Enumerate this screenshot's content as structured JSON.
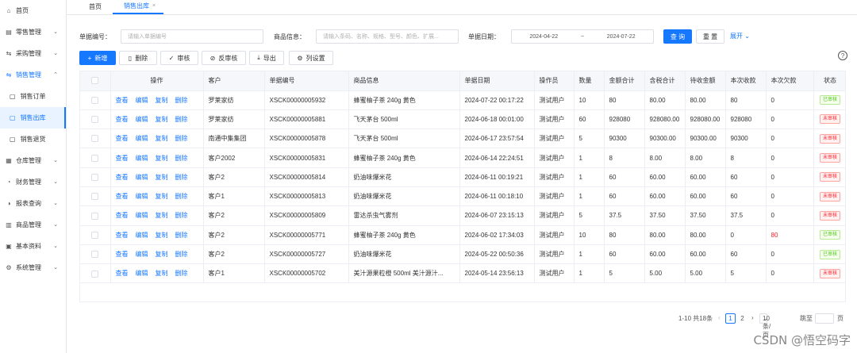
{
  "sidebar": {
    "items": [
      {
        "label": "首页",
        "icon": "home-icon",
        "glyph": "⌂",
        "has_chevron": false
      },
      {
        "label": "零售管理",
        "icon": "shop-icon",
        "glyph": "▤",
        "has_chevron": true
      },
      {
        "label": "采购管理",
        "icon": "cart-icon",
        "glyph": "⇆",
        "has_chevron": true
      },
      {
        "label": "销售管理",
        "icon": "sales-icon",
        "glyph": "⇋",
        "has_chevron": true,
        "expanded": true
      },
      {
        "label": "仓库管理",
        "icon": "warehouse-icon",
        "glyph": "▦",
        "has_chevron": true
      },
      {
        "label": "财务管理",
        "icon": "finance-icon",
        "glyph": "◔",
        "has_chevron": true
      },
      {
        "label": "报表查询",
        "icon": "report-icon",
        "glyph": "◑",
        "has_chevron": true
      },
      {
        "label": "商品管理",
        "icon": "goods-icon",
        "glyph": "▥",
        "has_chevron": true
      },
      {
        "label": "基本资料",
        "icon": "basic-data-icon",
        "glyph": "▣",
        "has_chevron": true
      },
      {
        "label": "系统管理",
        "icon": "system-icon",
        "glyph": "⚙",
        "has_chevron": true
      }
    ],
    "sub_items": [
      {
        "label": "销售订单",
        "icon": "doc-icon",
        "glyph": "▢",
        "active": false
      },
      {
        "label": "销售出库",
        "icon": "doc-icon",
        "glyph": "▢",
        "active": true
      },
      {
        "label": "销售退货",
        "icon": "doc-icon",
        "glyph": "▢",
        "active": false
      }
    ]
  },
  "tabs": [
    {
      "label": "首页",
      "active": false
    },
    {
      "label": "销售出库",
      "active": true,
      "close": "×"
    }
  ],
  "filters": {
    "doc_no_label": "单据编号：",
    "doc_no_placeholder": "请输入单据编号",
    "goods_label": "商品信息：",
    "goods_placeholder": "请输入条码、名称、规格、型号、颜色、扩展...",
    "date_label": "单据日期：",
    "date_start": "2024-04-22",
    "date_sep": "~",
    "date_end": "2024-07-22",
    "search_button": "查 询",
    "reset_button": "重 置",
    "expand_link": "展开"
  },
  "toolbar": {
    "add": "新增",
    "delete": "删除",
    "approve": "审核",
    "unapprove": "反审核",
    "export": "导出",
    "columns": "列设置"
  },
  "help_glyph": "?",
  "table": {
    "headers": [
      "操作",
      "客户",
      "单据编号",
      "商品信息",
      "单据日期",
      "操作员",
      "数量",
      "金额合计",
      "含税合计",
      "待收金额",
      "本次收款",
      "本次欠款",
      "状态"
    ],
    "actions": [
      "查看",
      "编辑",
      "复制",
      "删除"
    ],
    "rows": [
      {
        "customer": "罗莱家纺",
        "doc_no": "XSCK00000005932",
        "goods": "蜂蜜柚子茶 240g 黄色",
        "date": "2024-07-22 00:17:22",
        "operator": "测试用户",
        "qty": "10",
        "amount": "80",
        "tax_total": "80.00",
        "due": "80.00",
        "received": "80",
        "debt": "0",
        "debt_red": false,
        "status": "已审核",
        "status_ok": true
      },
      {
        "customer": "罗莱家纺",
        "doc_no": "XSCK00000005881",
        "goods": "飞天茅台 500ml",
        "date": "2024-06-18 00:01:00",
        "operator": "测试用户",
        "qty": "60",
        "amount": "928080",
        "tax_total": "928080.00",
        "due": "928080.00",
        "received": "928080",
        "debt": "0",
        "debt_red": false,
        "status": "未审核",
        "status_ok": false
      },
      {
        "customer": "南通中集集团",
        "doc_no": "XSCK00000005878",
        "goods": "飞天茅台 500ml",
        "date": "2024-06-17 23:57:54",
        "operator": "测试用户",
        "qty": "5",
        "amount": "90300",
        "tax_total": "90300.00",
        "due": "90300.00",
        "received": "90300",
        "debt": "0",
        "debt_red": false,
        "status": "未审核",
        "status_ok": false
      },
      {
        "customer": "客户2002",
        "doc_no": "XSCK00000005831",
        "goods": "蜂蜜柚子茶 240g 黄色",
        "date": "2024-06-14 22:24:51",
        "operator": "测试用户",
        "qty": "1",
        "amount": "8",
        "tax_total": "8.00",
        "due": "8.00",
        "received": "8",
        "debt": "0",
        "debt_red": false,
        "status": "未审核",
        "status_ok": false
      },
      {
        "customer": "客户2",
        "doc_no": "XSCK00000005814",
        "goods": "奶油味爆米花",
        "date": "2024-06-11 00:19:21",
        "operator": "测试用户",
        "qty": "1",
        "amount": "60",
        "tax_total": "60.00",
        "due": "60.00",
        "received": "60",
        "debt": "0",
        "debt_red": false,
        "status": "未审核",
        "status_ok": false
      },
      {
        "customer": "客户1",
        "doc_no": "XSCK00000005813",
        "goods": "奶油味爆米花",
        "date": "2024-06-11 00:18:10",
        "operator": "测试用户",
        "qty": "1",
        "amount": "60",
        "tax_total": "60.00",
        "due": "60.00",
        "received": "60",
        "debt": "0",
        "debt_red": false,
        "status": "未审核",
        "status_ok": false
      },
      {
        "customer": "客户2",
        "doc_no": "XSCK00000005809",
        "goods": "雷达杀虫气雾剂",
        "date": "2024-06-07 23:15:13",
        "operator": "测试用户",
        "qty": "5",
        "amount": "37.5",
        "tax_total": "37.50",
        "due": "37.50",
        "received": "37.5",
        "debt": "0",
        "debt_red": false,
        "status": "未审核",
        "status_ok": false
      },
      {
        "customer": "客户2",
        "doc_no": "XSCK00000005771",
        "goods": "蜂蜜柚子茶 240g 黄色",
        "date": "2024-06-02 17:34:03",
        "operator": "测试用户",
        "qty": "10",
        "amount": "80",
        "tax_total": "80.00",
        "due": "80.00",
        "received": "0",
        "debt": "80",
        "debt_red": true,
        "status": "已审核",
        "status_ok": true
      },
      {
        "customer": "客户2",
        "doc_no": "XSCK00000005727",
        "goods": "奶油味爆米花",
        "date": "2024-05-22 00:50:36",
        "operator": "测试用户",
        "qty": "1",
        "amount": "60",
        "tax_total": "60.00",
        "due": "60.00",
        "received": "60",
        "debt": "0",
        "debt_red": false,
        "status": "已审核",
        "status_ok": true
      },
      {
        "customer": "客户1",
        "doc_no": "XSCK00000005702",
        "goods": "美汁源果粒橙 500ml 美汁源汁...",
        "date": "2024-05-14 23:56:13",
        "operator": "测试用户",
        "qty": "1",
        "amount": "5",
        "tax_total": "5.00",
        "due": "5.00",
        "received": "5",
        "debt": "0",
        "debt_red": false,
        "status": "未审核",
        "status_ok": false
      }
    ]
  },
  "pagination": {
    "range": "1-10 共18条",
    "prev": "‹",
    "page1": "1",
    "page2": "2",
    "next": "›",
    "page_size": "10 条/页",
    "jump_label": "跳至",
    "page_suffix": "页"
  },
  "watermark": "CSDN @悟空码字",
  "colors": {
    "accent": "#1677ff",
    "approved": "#52c41a",
    "pending": "#f5222d"
  }
}
